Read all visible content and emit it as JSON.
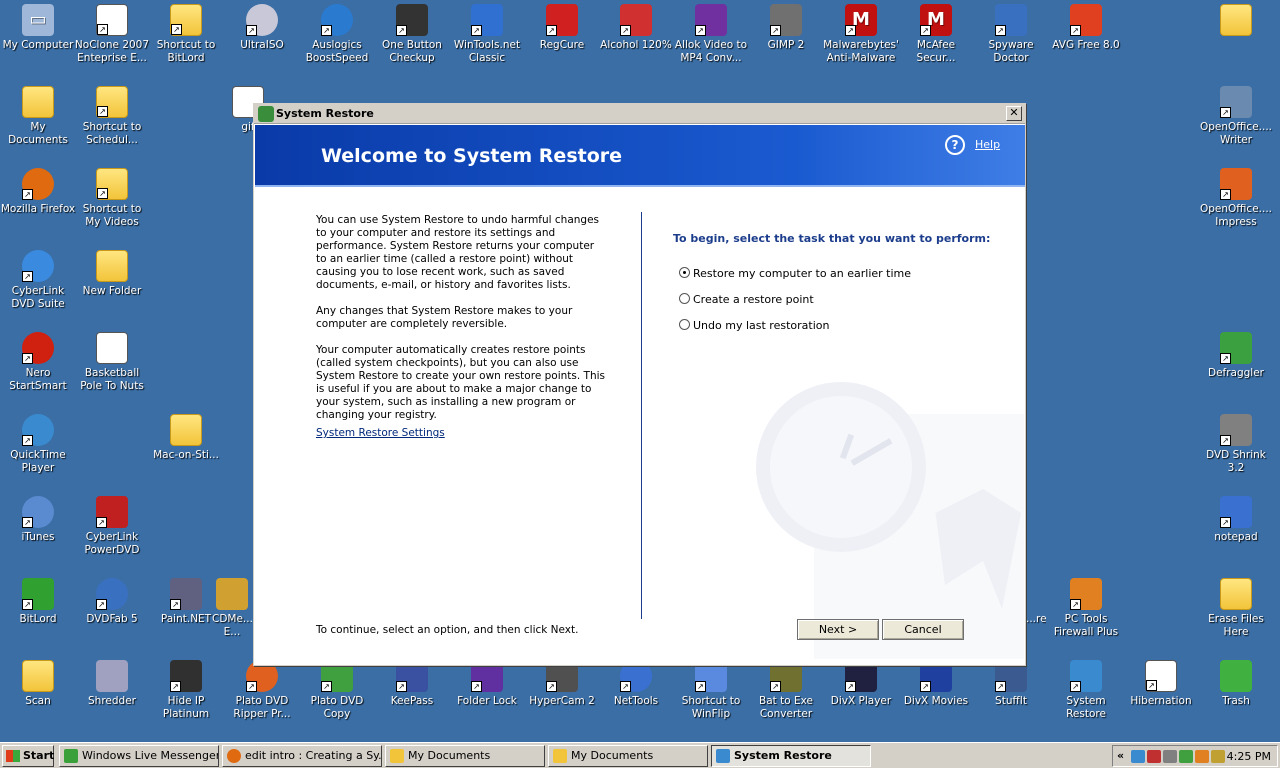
{
  "desktop": {
    "icons": [
      {
        "label": "My Computer",
        "icon": "computer-icon",
        "color": "#9fb7d9"
      },
      {
        "label": "NoClone 2007 Enteprise E...",
        "icon": "document-icon",
        "color": "#ffffff"
      },
      {
        "label": "Shortcut to BitLord",
        "icon": "folder-icon",
        "color": "#f2c43a"
      },
      {
        "label": "UltraISO",
        "icon": "disc-icon",
        "color": "#c8c8d8"
      },
      {
        "label": "Auslogics BoostSpeed",
        "icon": "globe-icon",
        "color": "#2a7ad0"
      },
      {
        "label": "One Button Checkup",
        "icon": "wizard-icon",
        "color": "#333333"
      },
      {
        "label": "WinTools.net Classic",
        "icon": "tools-icon",
        "color": "#3070d0"
      },
      {
        "label": "RegCure",
        "icon": "cube-icon",
        "color": "#d02020"
      },
      {
        "label": "Alcohol 120%",
        "icon": "alcohol-icon",
        "color": "#d03030"
      },
      {
        "label": "Allok Video to MP4 Conv...",
        "icon": "film-icon",
        "color": "#7030a0"
      },
      {
        "label": "GIMP 2",
        "icon": "gimp-icon",
        "color": "#707070"
      },
      {
        "label": "Malwarebytes' Anti-Malware",
        "icon": "m-icon",
        "color": "#c01010"
      },
      {
        "label": "McAfee Secur...",
        "icon": "mcafee-icon",
        "color": "#c01010"
      },
      {
        "label": "Spyware Doctor",
        "icon": "doctor-icon",
        "color": "#3a70c0"
      },
      {
        "label": "AVG Free 8.0",
        "icon": "avg-icon",
        "color": "#e04020"
      },
      {
        "label": "",
        "icon": "folder-icon",
        "color": "#f2c43a"
      },
      {
        "label": "My Documents",
        "icon": "folder-icon",
        "color": "#f2c43a"
      },
      {
        "label": "Shortcut to Schedul...",
        "icon": "folder-icon",
        "color": "#f2c43a"
      },
      {
        "label": "OpenOffice.... Writer",
        "icon": "writer-icon",
        "color": "#6a8ab0"
      },
      {
        "label": "Mozilla Firefox",
        "icon": "firefox-icon",
        "color": "#e06a10"
      },
      {
        "label": "Shortcut to My Videos",
        "icon": "folder-icon",
        "color": "#f2c43a"
      },
      {
        "label": "OpenOffice.... Impress",
        "icon": "impress-icon",
        "color": "#e06020"
      },
      {
        "label": "CyberLink DVD Suite",
        "icon": "cyberlink-icon",
        "color": "#3a8ae0"
      },
      {
        "label": "New Folder",
        "icon": "folder-icon",
        "color": "#f2c43a"
      },
      {
        "label": "Nero StartSmart",
        "icon": "nero-icon",
        "color": "#d02010"
      },
      {
        "label": "Basketball Pole To Nuts",
        "icon": "document-icon",
        "color": "#ffffff"
      },
      {
        "label": "Defraggler",
        "icon": "defraggler-icon",
        "color": "#3aa040"
      },
      {
        "label": "QuickTime Player",
        "icon": "quicktime-icon",
        "color": "#3a8ad0"
      },
      {
        "label": "Mac-on-Sti...",
        "icon": "folder-icon",
        "color": "#f2c43a"
      },
      {
        "label": "DVD Shrink 3.2",
        "icon": "shrink-icon",
        "color": "#808080"
      },
      {
        "label": "iTunes",
        "icon": "itunes-icon",
        "color": "#5a8ad0"
      },
      {
        "label": "CyberLink PowerDVD",
        "icon": "powerdvd-icon",
        "color": "#c02020"
      },
      {
        "label": "notepad",
        "icon": "notepad-icon",
        "color": "#3a70d0"
      },
      {
        "label": "BitLord",
        "icon": "bitlord-icon",
        "color": "#30a030"
      },
      {
        "label": "DVDFab 5",
        "icon": "dvdfab-icon",
        "color": "#3a70c0"
      },
      {
        "label": "Paint.NET",
        "icon": "paint-icon",
        "color": "#606080"
      },
      {
        "label": "CDMe... E...",
        "icon": "cd-icon",
        "color": "#d0a030"
      },
      {
        "label": "...re",
        "icon": "generic-icon",
        "color": "#3a6ea5"
      },
      {
        "label": "PC Tools Firewall Plus",
        "icon": "firewall-icon",
        "color": "#e08020"
      },
      {
        "label": "Erase Files Here",
        "icon": "folder-icon",
        "color": "#f2c43a"
      },
      {
        "label": "Scan",
        "icon": "folder-icon",
        "color": "#f2c43a"
      },
      {
        "label": "Shredder",
        "icon": "shredder-icon",
        "color": "#a0a0c0"
      },
      {
        "label": "Hide IP Platinum",
        "icon": "hideip-icon",
        "color": "#303030"
      },
      {
        "label": "Plato DVD Ripper Pr...",
        "icon": "plato-icon",
        "color": "#e06020"
      },
      {
        "label": "Plato DVD Copy",
        "icon": "platocopy-icon",
        "color": "#40a040"
      },
      {
        "label": "KeePass",
        "icon": "keepass-icon",
        "color": "#3a50a0"
      },
      {
        "label": "Folder Lock",
        "icon": "folderlock-icon",
        "color": "#6030a0"
      },
      {
        "label": "HyperCam 2",
        "icon": "camera-icon",
        "color": "#505050"
      },
      {
        "label": "NetTools",
        "icon": "nettools-icon",
        "color": "#3a70d0"
      },
      {
        "label": "Shortcut to WinFlip",
        "icon": "winflip-icon",
        "color": "#5a8ae0"
      },
      {
        "label": "Bat to Exe Converter",
        "icon": "gear-icon",
        "color": "#707030"
      },
      {
        "label": "DivX Player",
        "icon": "divx-icon",
        "color": "#202040"
      },
      {
        "label": "DivX Movies",
        "icon": "divxmovies-icon",
        "color": "#2040a0"
      },
      {
        "label": "StuffIt",
        "icon": "stuffit-icon",
        "color": "#3a5a90"
      },
      {
        "label": "System Restore",
        "icon": "restore-icon",
        "color": "#3a8ad0"
      },
      {
        "label": "Hibernation",
        "icon": "document-icon",
        "color": "#ffffff"
      },
      {
        "label": "Trash",
        "icon": "recycle-icon",
        "color": "#40b040"
      },
      {
        "label": "gif",
        "icon": "document-icon",
        "color": "#ffffff"
      }
    ]
  },
  "window": {
    "title": "System Restore",
    "close_glyph": "✕",
    "banner_title": "Welcome to System Restore",
    "help_label": "Help",
    "help_glyph": "?",
    "intro": [
      "You can use System Restore to undo harmful changes to your computer and restore its settings and performance. System Restore returns your computer to an earlier time (called a restore point) without causing you to lose recent work, such as saved documents, e-mail, or history and favorites lists.",
      "Any changes that System Restore makes to your computer are completely reversible.",
      "Your computer automatically creates restore points (called system checkpoints), but you can also use System Restore to create your own restore points. This is useful if you are about to make a major change to your system, such as installing a new program or changing your registry."
    ],
    "settings_link": "System Restore Settings",
    "prompt": "To begin, select the task that you want to perform:",
    "options": [
      {
        "label": "Restore my computer to an earlier time",
        "selected": true
      },
      {
        "label": "Create a restore point",
        "selected": false
      },
      {
        "label": "Undo my last restoration",
        "selected": false
      }
    ],
    "footer": "To continue, select an option, and then click Next.",
    "next_label": "Next >",
    "cancel_label": "Cancel"
  },
  "taskbar": {
    "start_label": "Start",
    "tasks": [
      {
        "label": "Windows Live Messenger",
        "active": false,
        "icon": "messenger-icon",
        "color": "#3aa03a"
      },
      {
        "label": "edit intro : Creating a Sy...",
        "active": false,
        "icon": "firefox-icon",
        "color": "#e06a10"
      },
      {
        "label": "My Documents",
        "active": false,
        "icon": "folder-icon",
        "color": "#f2c43a"
      },
      {
        "label": "My Documents",
        "active": false,
        "icon": "folder-icon",
        "color": "#f2c43a"
      },
      {
        "label": "System Restore",
        "active": true,
        "icon": "restore-icon",
        "color": "#3a8ad0"
      }
    ],
    "tray_chevron": "«",
    "clock": "4:25 PM"
  },
  "colors": {
    "desktop_bg": "#3a6ea5",
    "banner_blue": "#0a3aa8",
    "prompt_blue": "#1c3d8c",
    "link_blue": "#00287a"
  }
}
